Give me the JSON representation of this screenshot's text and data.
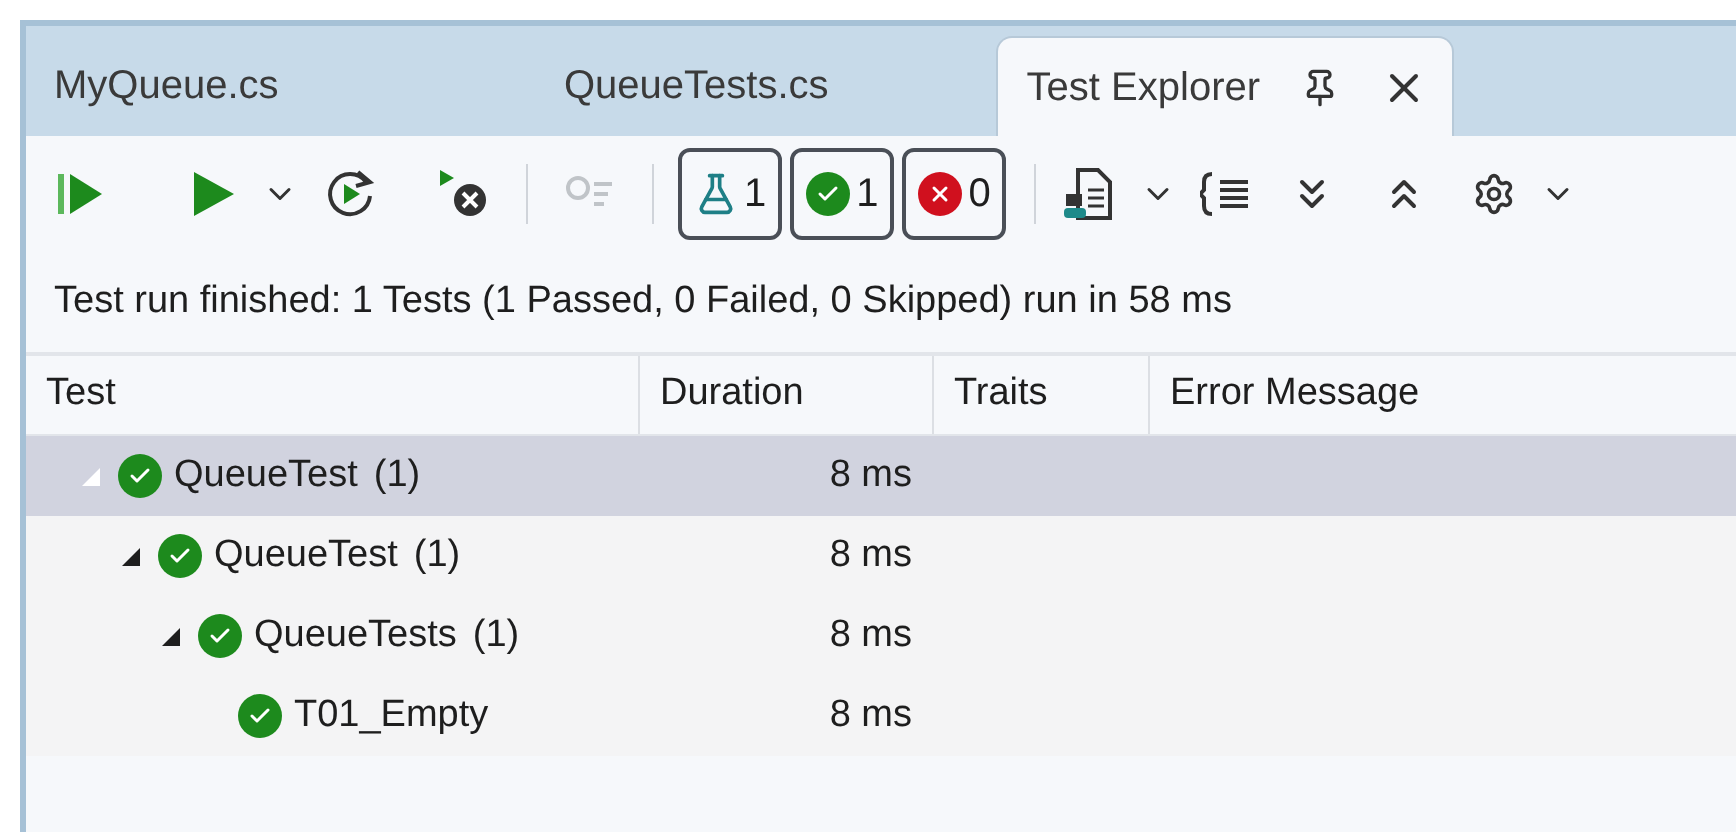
{
  "tabs": [
    {
      "label": "MyQueue.cs",
      "selected": false
    },
    {
      "label": "QueueTests.cs",
      "selected": false
    },
    {
      "label": "Test Explorer",
      "selected": true
    }
  ],
  "toolbar": {
    "filters": [
      {
        "kind": "total",
        "count": "1"
      },
      {
        "kind": "passed",
        "count": "1"
      },
      {
        "kind": "failed",
        "count": "0"
      }
    ]
  },
  "status": "Test run finished: 1 Tests (1 Passed, 0 Failed, 0 Skipped) run in 58 ms",
  "table": {
    "columns": [
      "Test",
      "Duration",
      "Traits",
      "Error Message"
    ],
    "rows": [
      {
        "name": "QueueTest",
        "count": "(1)",
        "duration": "8 ms",
        "kind": "passed",
        "selected": true,
        "expanded": true,
        "children": [
          {
            "name": "QueueTest",
            "count": "(1)",
            "duration": "8 ms",
            "kind": "passed",
            "selected": false,
            "expanded": true,
            "children": [
              {
                "name": "QueueTests",
                "count": "(1)",
                "duration": "8 ms",
                "kind": "passed",
                "selected": false,
                "expanded": true,
                "children": [
                  {
                    "name": "T01_Empty",
                    "duration": "8 ms",
                    "kind": "passed",
                    "selected": false
                  }
                ]
              }
            ]
          }
        ]
      }
    ]
  }
}
